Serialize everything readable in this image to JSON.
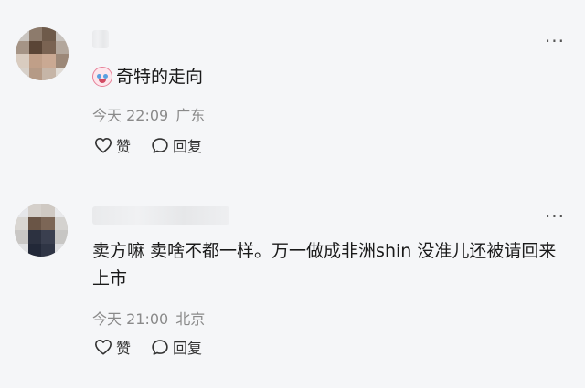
{
  "comments": [
    {
      "text": "奇特的走向",
      "emoji_icon": "crying-laughing-face-icon",
      "time": "今天 22:09",
      "location": "广东",
      "like_label": "赞",
      "reply_label": "回复",
      "more_icon": "more-icon"
    },
    {
      "text": "卖方嘛 卖啥不都一样。万一做成非洲shin 没准儿还被请回来上市",
      "time": "今天 21:00",
      "location": "北京",
      "like_label": "赞",
      "reply_label": "回复",
      "more_icon": "more-icon"
    }
  ],
  "colors": {
    "background": "#f5f6f8",
    "text": "#1a1a1a",
    "meta": "#8a8a8a"
  }
}
